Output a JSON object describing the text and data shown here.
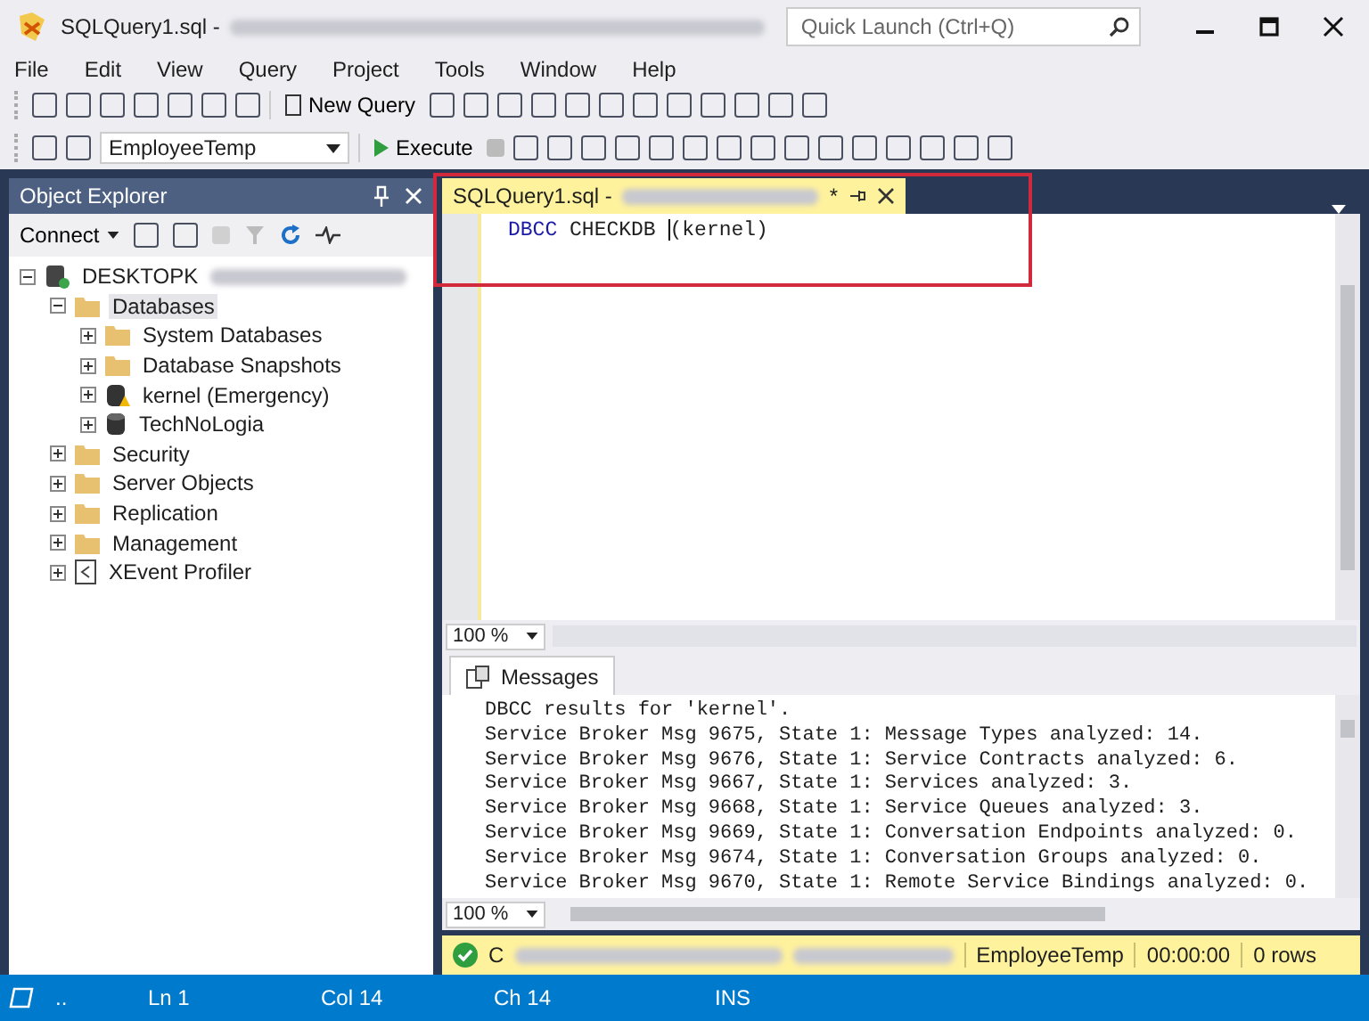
{
  "window": {
    "title": "SQLQuery1.sql -",
    "quick_launch": {
      "placeholder": "Quick Launch (Ctrl+Q)"
    }
  },
  "menu": [
    "File",
    "Edit",
    "View",
    "Query",
    "Project",
    "Tools",
    "Window",
    "Help"
  ],
  "toolbar": {
    "new_query": "New Query",
    "database": "EmployeeTemp",
    "execute": "Execute"
  },
  "object_explorer": {
    "title": "Object Explorer",
    "connect": "Connect",
    "tree": [
      {
        "label": "DESKTOPK",
        "kind": "server",
        "expanded": true,
        "selected": false,
        "children": [
          {
            "label": "Databases",
            "kind": "folder",
            "expanded": true,
            "selected": true,
            "children": [
              {
                "label": "System Databases",
                "kind": "folder",
                "expanded": false,
                "selected": false
              },
              {
                "label": "Database Snapshots",
                "kind": "folder",
                "expanded": false,
                "selected": false
              },
              {
                "label": "kernel (Emergency)",
                "kind": "database-warning",
                "expanded": false,
                "selected": false
              },
              {
                "label": "TechNoLogia",
                "kind": "database",
                "expanded": false,
                "selected": false
              }
            ]
          },
          {
            "label": "Security",
            "kind": "folder",
            "expanded": false,
            "selected": false
          },
          {
            "label": "Server Objects",
            "kind": "folder",
            "expanded": false,
            "selected": false
          },
          {
            "label": "Replication",
            "kind": "folder",
            "expanded": false,
            "selected": false
          },
          {
            "label": "Management",
            "kind": "folder",
            "expanded": false,
            "selected": false
          },
          {
            "label": "XEvent Profiler",
            "kind": "profiler",
            "expanded": false,
            "selected": false
          }
        ]
      }
    ]
  },
  "editor": {
    "tab": {
      "title": "SQLQuery1.sql -",
      "modified": "*"
    },
    "code": {
      "keyword": "DBCC",
      "rest": "CHECKDB",
      "args": "(kernel)"
    },
    "zoom": "100 %"
  },
  "results": {
    "tab": "Messages",
    "lines": [
      "DBCC results for 'kernel'.",
      "Service Broker Msg 9675, State 1: Message Types analyzed: 14.",
      "Service Broker Msg 9676, State 1: Service Contracts analyzed: 6.",
      "Service Broker Msg 9667, State 1: Services analyzed: 3.",
      "Service Broker Msg 9668, State 1: Service Queues analyzed: 3.",
      "Service Broker Msg 9669, State 1: Conversation Endpoints analyzed: 0.",
      "Service Broker Msg 9674, State 1: Conversation Groups analyzed: 0.",
      "Service Broker Msg 9670, State 1: Remote Service Bindings analyzed: 0."
    ],
    "zoom": "100 %",
    "status": {
      "prefix": "C",
      "database": "EmployeeTemp",
      "time": "00:00:00",
      "rows": "0 rows"
    }
  },
  "status_bar": {
    "dots": "..",
    "line": "Ln 1",
    "column": "Col 14",
    "char": "Ch 14",
    "mode": "INS"
  }
}
